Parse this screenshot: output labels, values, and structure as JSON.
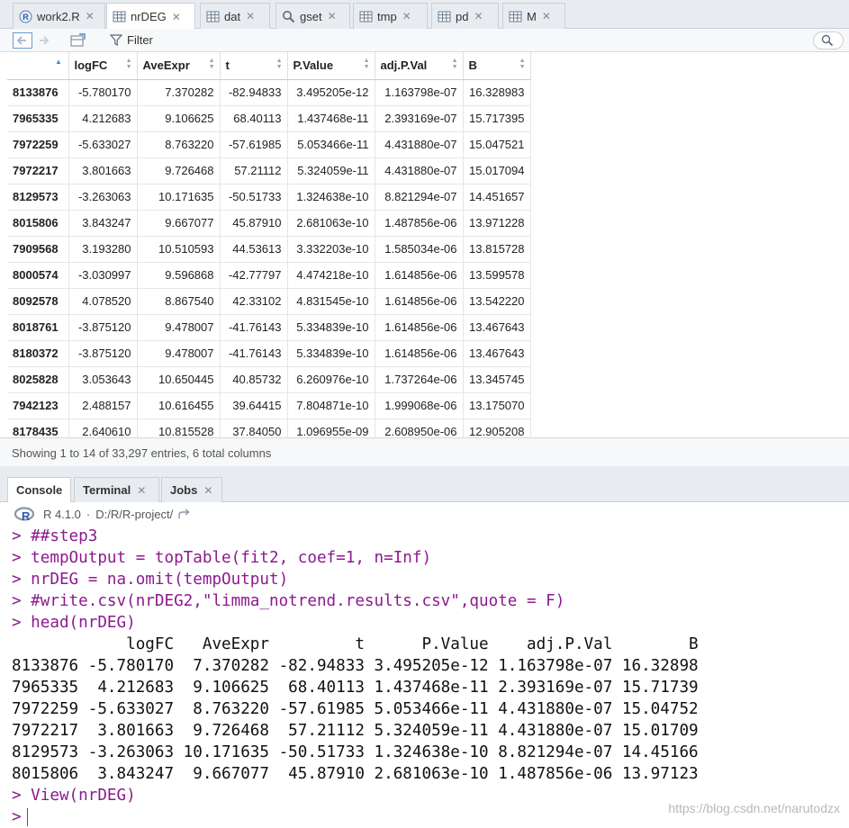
{
  "editor_tabs": [
    {
      "label": "work2.R",
      "icon": "r-file-icon"
    },
    {
      "label": "nrDEG",
      "icon": "table-icon",
      "active": true
    },
    {
      "label": "dat",
      "icon": "table-icon"
    },
    {
      "label": "gset",
      "icon": "magnifier-icon"
    },
    {
      "label": "tmp",
      "icon": "table-icon"
    },
    {
      "label": "pd",
      "icon": "table-icon"
    },
    {
      "label": "M",
      "icon": "table-icon"
    }
  ],
  "toolbar": {
    "filter_label": "Filter"
  },
  "grid": {
    "columns": [
      "",
      "logFC",
      "AveExpr",
      "t",
      "P.Value",
      "adj.P.Val",
      "B"
    ],
    "rows": [
      [
        "8133876",
        "-5.780170",
        "7.370282",
        "-82.94833",
        "3.495205e-12",
        "1.163798e-07",
        "16.328983"
      ],
      [
        "7965335",
        "4.212683",
        "9.106625",
        "68.40113",
        "1.437468e-11",
        "2.393169e-07",
        "15.717395"
      ],
      [
        "7972259",
        "-5.633027",
        "8.763220",
        "-57.61985",
        "5.053466e-11",
        "4.431880e-07",
        "15.047521"
      ],
      [
        "7972217",
        "3.801663",
        "9.726468",
        "57.21112",
        "5.324059e-11",
        "4.431880e-07",
        "15.017094"
      ],
      [
        "8129573",
        "-3.263063",
        "10.171635",
        "-50.51733",
        "1.324638e-10",
        "8.821294e-07",
        "14.451657"
      ],
      [
        "8015806",
        "3.843247",
        "9.667077",
        "45.87910",
        "2.681063e-10",
        "1.487856e-06",
        "13.971228"
      ],
      [
        "7909568",
        "3.193280",
        "10.510593",
        "44.53613",
        "3.332203e-10",
        "1.585034e-06",
        "13.815728"
      ],
      [
        "8000574",
        "-3.030997",
        "9.596868",
        "-42.77797",
        "4.474218e-10",
        "1.614856e-06",
        "13.599578"
      ],
      [
        "8092578",
        "4.078520",
        "8.867540",
        "42.33102",
        "4.831545e-10",
        "1.614856e-06",
        "13.542220"
      ],
      [
        "8018761",
        "-3.875120",
        "9.478007",
        "-41.76143",
        "5.334839e-10",
        "1.614856e-06",
        "13.467643"
      ],
      [
        "8180372",
        "-3.875120",
        "9.478007",
        "-41.76143",
        "5.334839e-10",
        "1.614856e-06",
        "13.467643"
      ],
      [
        "8025828",
        "3.053643",
        "10.650445",
        "40.85732",
        "6.260976e-10",
        "1.737264e-06",
        "13.345745"
      ],
      [
        "7942123",
        "2.488157",
        "10.616455",
        "39.64415",
        "7.804871e-10",
        "1.999068e-06",
        "13.175070"
      ],
      [
        "8178435",
        "2.640610",
        "10.815528",
        "37.84050",
        "1.096955e-09",
        "2.608950e-06",
        "12.905208"
      ]
    ]
  },
  "status": {
    "text": "Showing 1 to 14 of 33,297 entries, 6 total columns"
  },
  "console_tabs": [
    {
      "label": "Console",
      "active": true
    },
    {
      "label": "Terminal"
    },
    {
      "label": "Jobs"
    }
  ],
  "console_info": {
    "version": "R 4.1.0",
    "separator": "·",
    "path": "D:/R/R-project/"
  },
  "console": {
    "lines": [
      {
        "type": "in",
        "text": "> ##step3"
      },
      {
        "type": "in",
        "text": "> tempOutput = topTable(fit2, coef=1, n=Inf)"
      },
      {
        "type": "in",
        "text": "> nrDEG = na.omit(tempOutput)"
      },
      {
        "type": "in",
        "text": "> #write.csv(nrDEG2,\"limma_notrend.results.csv\",quote = F)"
      },
      {
        "type": "in",
        "text": "> head(nrDEG)"
      },
      {
        "type": "out",
        "text": "            logFC   AveExpr         t      P.Value    adj.P.Val        B"
      },
      {
        "type": "out",
        "text": "8133876 -5.780170  7.370282 -82.94833 3.495205e-12 1.163798e-07 16.32898"
      },
      {
        "type": "out",
        "text": "7965335  4.212683  9.106625  68.40113 1.437468e-11 2.393169e-07 15.71739"
      },
      {
        "type": "out",
        "text": "7972259 -5.633027  8.763220 -57.61985 5.053466e-11 4.431880e-07 15.04752"
      },
      {
        "type": "out",
        "text": "7972217  3.801663  9.726468  57.21112 5.324059e-11 4.431880e-07 15.01709"
      },
      {
        "type": "out",
        "text": "8129573 -3.263063 10.171635 -50.51733 1.324638e-10 8.821294e-07 14.45166"
      },
      {
        "type": "out",
        "text": "8015806  3.843247  9.667077  45.87910 2.681063e-10 1.487856e-06 13.97123"
      },
      {
        "type": "in",
        "text": "> View(nrDEG)"
      }
    ],
    "prompt": ">"
  },
  "watermark": "https://blog.csdn.net/narutodzx"
}
